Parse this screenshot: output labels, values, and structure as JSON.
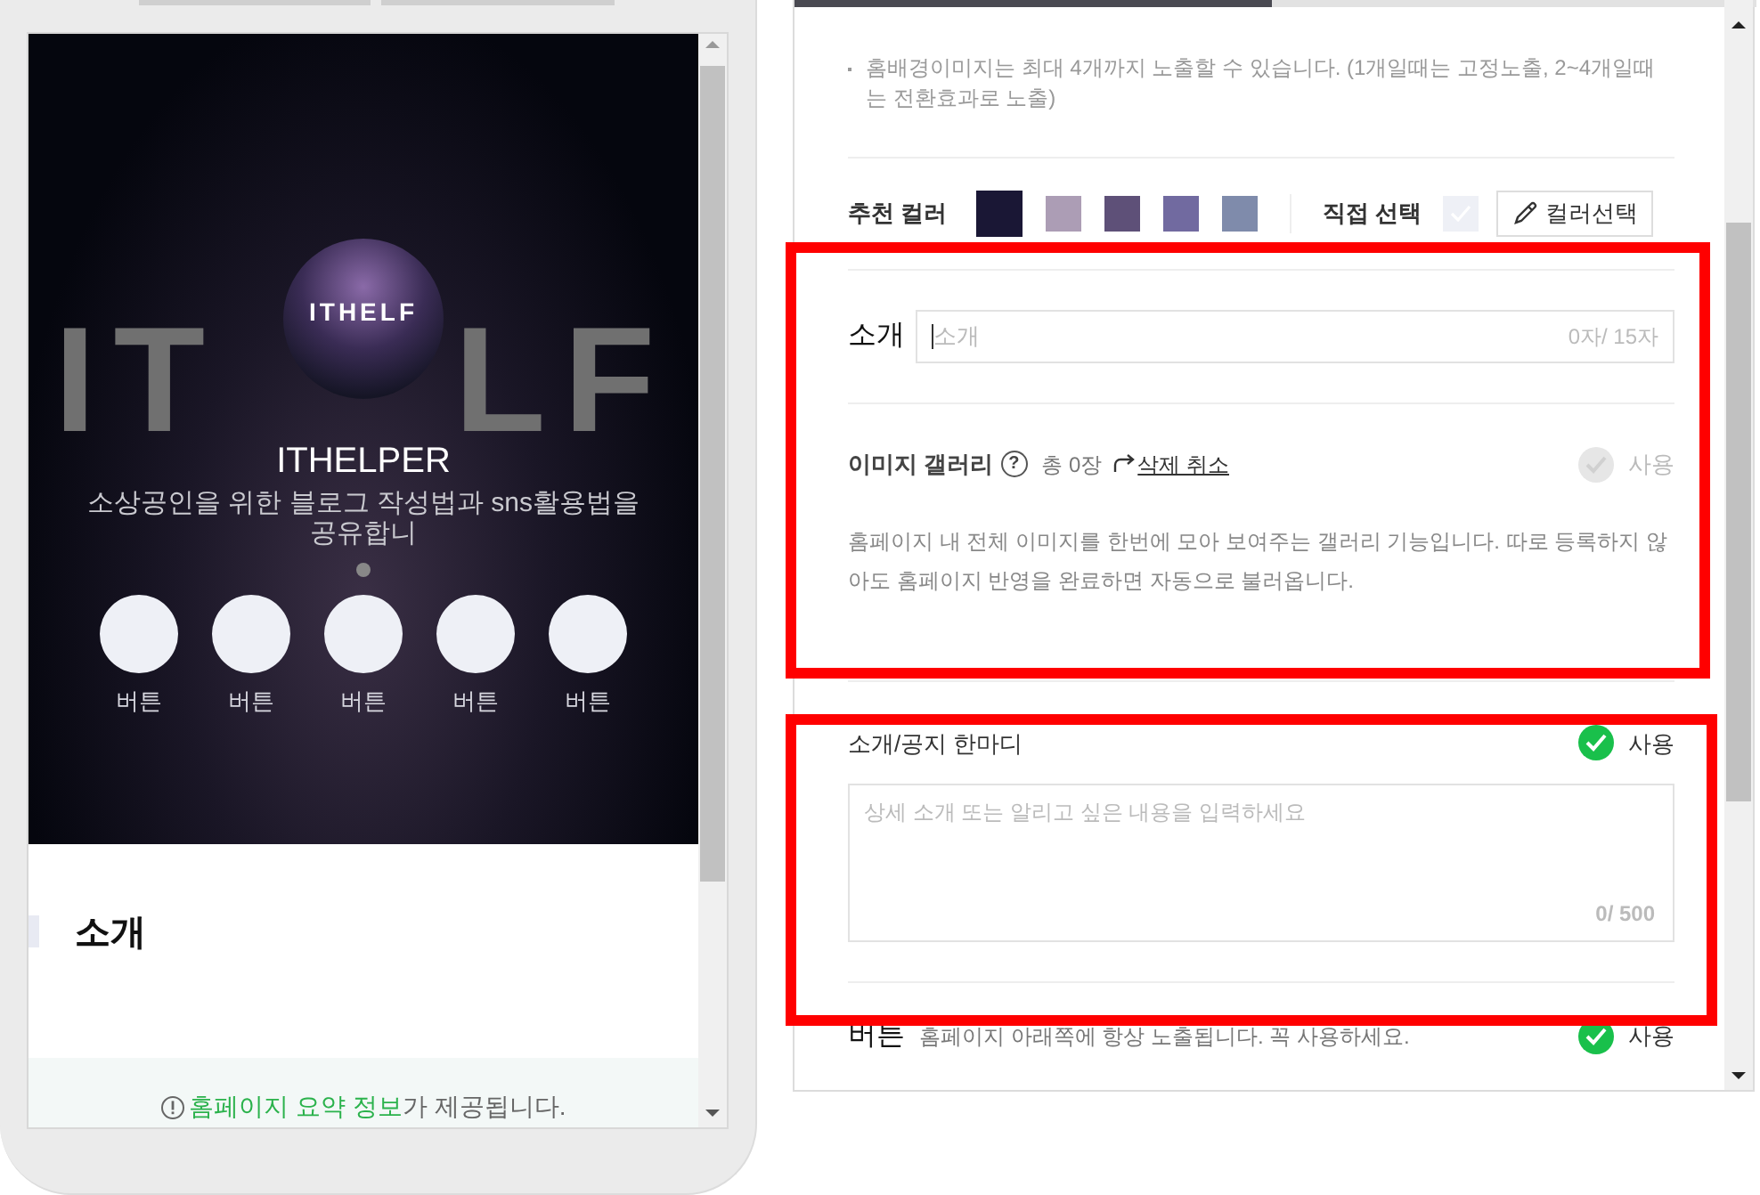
{
  "preview": {
    "logo_text": "ITHELF",
    "watermark_left": "IT",
    "watermark_right": "LF",
    "title": "ITHELPER",
    "subtitle": "소상공인을 위한 블로그 작성법과 sns활용법을 공유합니",
    "buttons": [
      {
        "label": "버튼"
      },
      {
        "label": "버튼"
      },
      {
        "label": "버튼"
      },
      {
        "label": "버튼"
      },
      {
        "label": "버튼"
      }
    ],
    "section_title": "소개",
    "footer": {
      "link": "홈페이지 요약 정보",
      "text": "가 제공됩니다."
    }
  },
  "settings": {
    "note": "홈배경이미지는 최대 4개까지 노출할 수 있습니다. (1개일때는 고정노출, 2~4개일때는 전환효과로 노출)",
    "colors": {
      "label": "추천 컬러",
      "swatches": [
        {
          "color": "#1a1735",
          "selected": true
        },
        {
          "color": "#ac9db5",
          "selected": false
        },
        {
          "color": "#5e5078",
          "selected": false
        },
        {
          "color": "#716aa0",
          "selected": false
        },
        {
          "color": "#7f8bab",
          "selected": false
        }
      ],
      "direct_label": "직접 선택",
      "direct_checked": false,
      "picker_button": "컬러선택"
    },
    "intro": {
      "label": "소개",
      "placeholder": "소개",
      "counter": "0자/ 15자"
    },
    "gallery": {
      "title": "이미지 갤러리",
      "help": "?",
      "count": "총 0장",
      "undo": "삭제 취소",
      "use": {
        "label": "사용",
        "checked": true,
        "disabled": true
      },
      "description": "홈페이지 내 전체 이미지를 한번에 모아 보여주는 갤러리 기능입니다. 따로 등록하지 않아도 홈페이지 반영을 완료하면 자동으로 불러옵니다."
    },
    "notice": {
      "title": "소개/공지 한마디",
      "use": {
        "label": "사용",
        "checked": true,
        "disabled": false
      },
      "placeholder": "상세 소개 또는 알리고 싶은 내용을 입력하세요",
      "counter": "0/ 500"
    },
    "button_section": {
      "title": "버튼",
      "description": "홈페이지 아래쪽에 항상 노출됩니다. 꼭 사용하세요.",
      "use": {
        "label": "사용",
        "checked": true,
        "disabled": false
      }
    }
  }
}
